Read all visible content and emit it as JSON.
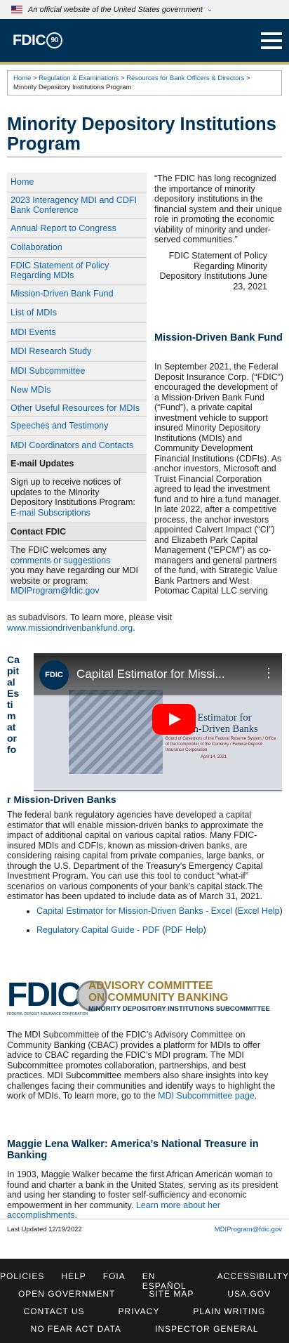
{
  "gov_banner": {
    "text": "An official website of the United States government"
  },
  "header": {
    "logo_text": "FDIC",
    "logo_anniversary": "90"
  },
  "breadcrumb": {
    "items": [
      "Home",
      "Regulation & Examinations",
      "Resources for Bank Officers & Directors"
    ],
    "separator": ">",
    "current": "Minority Depository Institutions Program"
  },
  "page_title": "Minority Depository Institutions Program",
  "sidebar": {
    "items": [
      "Home",
      "2023 Interagency MDI and CDFI Bank Conference",
      "Annual Report to Congress",
      "Collaboration",
      "FDIC Statement of Policy Regarding MDIs",
      "Mission-Driven Bank Fund",
      "List of MDIs",
      "MDI Events",
      "MDI Research Study",
      "MDI Subcommittee",
      "New MDIs",
      "Other Useful Resources for MDIs",
      "Speeches and Testimony",
      "MDI Coordinators and Contacts"
    ],
    "email_heading": "E-mail Updates",
    "email_text": "Sign up to receive notices of updates to the Minority Depository Institutions Program:",
    "email_link": "E-mail Subscriptions",
    "contact_heading": "Contact FDIC",
    "contact_text_1": "The FDIC welcomes any",
    "contact_link": "comments or suggestions",
    "contact_text_2": "you may have regarding our MDI website or program:",
    "contact_email": "MDIProgram@fdic.gov"
  },
  "quote": {
    "text": "“The FDIC has long recognized the importance of minority depository institutions in the financial system and their unique role in promoting the economic viability of minority and under-served communities.”",
    "attribution": "FDIC Statement of Policy Regarding Minority Depository Institutions June 23, 2021"
  },
  "mission_fund": {
    "heading": "Mission-Driven Bank Fund",
    "body": "In September 2021, the Federal Deposit Insurance Corp. (“FDIC”) encouraged the development of a Mission-Driven Bank Fund (“Fund”), a private capital investment vehicle to support insured Minority Depository Institutions (MDIs) and Community Development Financial Institutions (CDFIs). As anchor investors, Microsoft and Truist Financial Corporation agreed to lead the investment fund and to hire a fund manager. In late 2022, after a competitive process, the anchor investors appointed Calvert Impact (“CI”) and Elizabeth Park Capital Management (“EPCM”) as co-managers and general partners of the fund, with Strategic Value Bank Partners and West Potomac Capital LLC serving",
    "body_cont": "as subadvisors. To learn more, please visit",
    "link": "www.missiondrivenbankfund.org",
    "link_suffix": "."
  },
  "capital_estimator": {
    "heading": "Capital Estimator for Mission-Driven Banks",
    "video": {
      "channel": "FDIC",
      "title": "Capital Estimator for Missi...",
      "card_title": "Capital Estimator for Mission-Driven Banks",
      "card_sub": "Board of Governors of the Federal Reserve System / Office of the Comptroller of the Currency / Federal Deposit Insurance Corporation",
      "card_date": "April 14, 2021"
    },
    "body": "The federal bank regulatory agencies have developed a capital estimator that will enable mission-driven banks to approximate the impact of additional capital on various capital ratios. Many FDIC-insured MDIs and CDFIs, known as mission-driven banks, are considering raising capital from private companies, large banks, or through the U.S. Department of the Treasury’s Emergency Capital Investment Program. You can use this tool to conduct “what-if” scenarios on various components of your bank’s capital stack.The estimator has been updated to include data as of March 31, 2021.",
    "links": [
      {
        "label": "Capital Estimator for Mission-Driven Banks - Excel",
        "help": "Excel Help"
      },
      {
        "label": "Regulatory Capital Guide - PDF",
        "help": "PDF Help"
      }
    ]
  },
  "cbac": {
    "logo_text": "FDIC",
    "corp_text": "FEDERAL DEPOSIT INSURANCE CORPORATION",
    "title_1": "ADVISORY COMMITTEE",
    "title_2": "ON COMMUNITY BANKING",
    "subtitle": "MINORITY DEPOSITORY INSTITUTIONS SUBCOMMITTEE",
    "body": "The MDI Subcommittee of the FDIC’s Advisory Committee on Community Banking (CBAC) provides a platform for MDIs to offer advice to CBAC regarding the FDIC’s MDI program. The MDI Subcommittee promotes collaboration, partnerships, and best practices. MDI Subcommittee members also share insights into key challenges facing their communities and identify ways to highlight the work of MDIs. To learn more, go to the",
    "link": "MDI Subcommittee page",
    "link_suffix": "."
  },
  "maggie": {
    "heading": "Maggie Lena Walker: America’s National Treasure in Banking",
    "body": "In 1903, Maggie Walker became the first African American woman to found and charter a bank in the United States, serving as its president and using her standing to foster self-sufficiency and economic empowerment in her community.",
    "link": "Learn more about her accomplishments",
    "link_suffix": "."
  },
  "page_footer": {
    "updated": "Last Updated 12/19/2022",
    "email": "MDIProgram@fdic.gov"
  },
  "footer_links": {
    "row1": [
      "Policies",
      "Help",
      "FOIA",
      "En Español",
      "Accessibility"
    ],
    "row2": [
      "Open Government",
      "Site Map",
      "USA.gov"
    ],
    "row3": [
      "Contact Us",
      "Privacy",
      "Plain Writing"
    ],
    "row4": [
      "No FEAR Act Data",
      "Inspector General"
    ]
  },
  "colors": {
    "navy": "#003256",
    "link": "#0c63b0",
    "gold": "#c9b06b",
    "footer_bg": "#1b1b1b"
  }
}
